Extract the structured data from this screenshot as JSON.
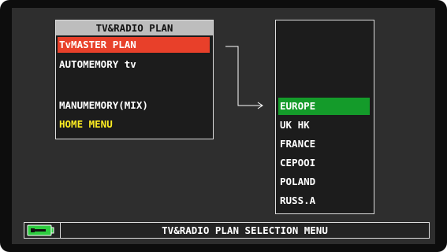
{
  "menu": {
    "title": "TV&RADIO PLAN",
    "items": [
      {
        "label": "TvMASTER PLAN",
        "selected": true
      },
      {
        "label": "AUTOMEMORY tv"
      },
      {
        "label": "MANUMEMORY(MIX)"
      },
      {
        "label": "HOME MENU"
      }
    ]
  },
  "plan_list": {
    "items": [
      {
        "label": "EUROPE",
        "selected": true
      },
      {
        "label": "UK HK"
      },
      {
        "label": "FRANCE"
      },
      {
        "label": "CEPOOI"
      },
      {
        "label": "POLAND"
      },
      {
        "label": "RUSS.A"
      }
    ]
  },
  "status_bar": {
    "text": "TV&RADIO PLAN SELECTION MENU",
    "battery_icon": "battery-charging-icon"
  },
  "colors": {
    "menu_highlight": "#e8402a",
    "list_highlight": "#149b2a",
    "home_menu_text": "#ffee22",
    "battery": "#2ecc40"
  }
}
